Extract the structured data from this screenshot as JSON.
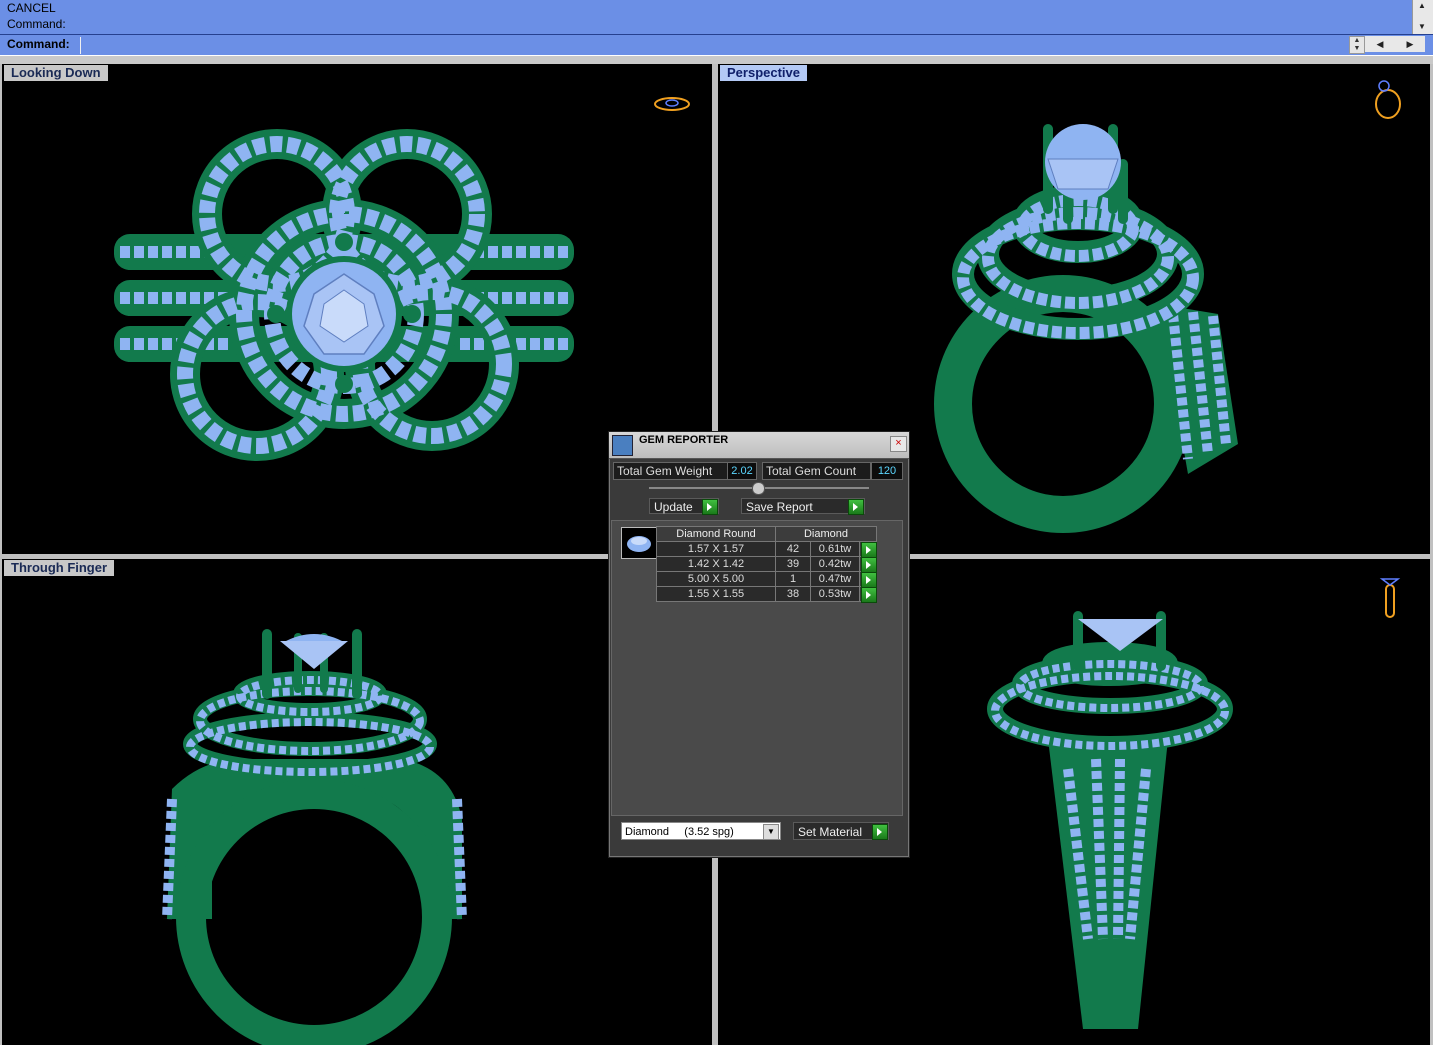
{
  "command": {
    "history": [
      "CANCEL",
      "Command:"
    ],
    "prompt_label": "Command:",
    "input_value": ""
  },
  "viewports": {
    "top_left": {
      "title": "Looking Down"
    },
    "top_right": {
      "title": "Perspective"
    },
    "bottom_left": {
      "title": "Through Finger"
    },
    "bottom_right": {
      "title": ""
    }
  },
  "gem_reporter": {
    "title": "GEM REPORTER",
    "total_weight_label": "Total Gem Weight",
    "total_weight_value": "2.02",
    "total_count_label": "Total Gem Count",
    "total_count_value": "120",
    "update_label": "Update",
    "save_report_label": "Save Report",
    "table": {
      "shape_header": "Diamond Round",
      "material_header": "Diamond",
      "rows": [
        {
          "size": "1.57 X 1.57",
          "count": "42",
          "weight": "0.61tw"
        },
        {
          "size": "1.42 X 1.42",
          "count": "39",
          "weight": "0.42tw"
        },
        {
          "size": "5.00 X 5.00",
          "count": "1",
          "weight": "0.47tw"
        },
        {
          "size": "1.55 X 1.55",
          "count": "38",
          "weight": "0.53tw"
        }
      ]
    },
    "material_select": "Diamond     (3.52 spg)",
    "set_material_label": "Set Material"
  },
  "colors": {
    "metal": "#127a4c",
    "gem": "#8fb4f2",
    "command_bg": "#6b8fe6",
    "value_text": "#5cd7ff"
  }
}
